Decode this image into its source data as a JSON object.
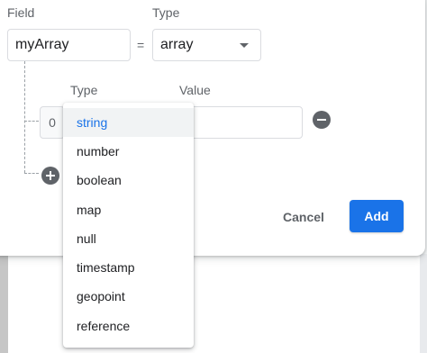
{
  "form": {
    "field_label": "Field",
    "type_label": "Type",
    "field_value": "myArray",
    "equals": "=",
    "type_value": "array"
  },
  "array_row": {
    "type_label": "Type",
    "value_label": "Value",
    "index": "0"
  },
  "actions": {
    "cancel_label": "Cancel",
    "add_label": "Add"
  },
  "type_options": [
    "string",
    "number",
    "boolean",
    "map",
    "null",
    "timestamp",
    "geopoint",
    "reference"
  ],
  "selected_option": "string",
  "colors": {
    "accent": "#1a73e8",
    "icon_gray": "#5f6368",
    "selected_bg": "#f1f3f4"
  }
}
